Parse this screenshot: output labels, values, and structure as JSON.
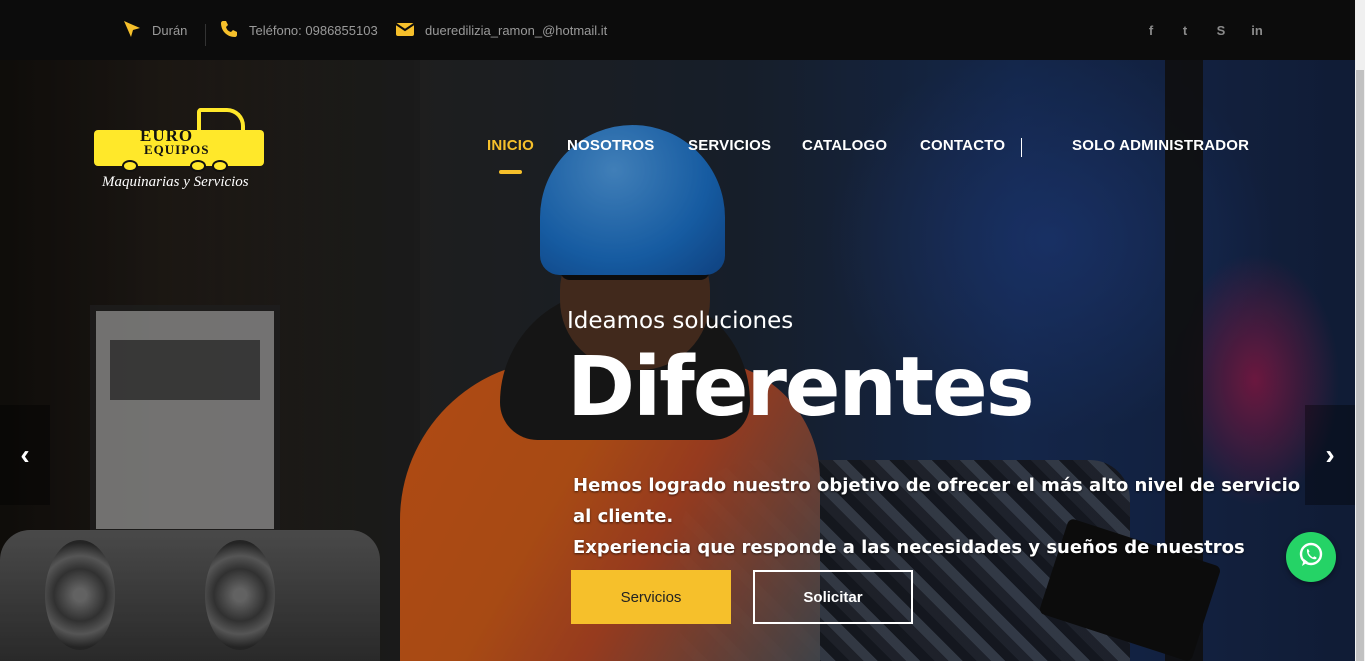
{
  "topbar": {
    "location": "Durán",
    "phone": "Teléfono: 0986855103",
    "email": "dueredilizia_ramon_@hotmail.it",
    "social": [
      {
        "icon": "facebook-icon",
        "glyph": "f"
      },
      {
        "icon": "twitter-icon",
        "glyph": "t"
      },
      {
        "icon": "skype-icon",
        "glyph": "S"
      },
      {
        "icon": "linkedin-icon",
        "glyph": "in"
      }
    ]
  },
  "logo": {
    "line1": "EURO",
    "line2": "EQUIPOS",
    "tagline": "Maquinarias y Servicios"
  },
  "nav": {
    "inicio": "INICIO",
    "nosotros": "NOSOTROS",
    "servicios": "SERVICIOS",
    "catalogo": "CATALOGO",
    "contacto": "CONTACTO",
    "admin": "SOLO ADMINISTRADOR"
  },
  "hero": {
    "subtitle": "Ideamos soluciones",
    "title": "Diferentes",
    "description_line1": "Hemos logrado nuestro objetivo de ofrecer el más alto nivel de servicio al cliente.",
    "description_line2": "Experiencia que responde a las necesidades y sueños de nuestros clientes.",
    "primary_button": "Servicios",
    "secondary_button": "Solicitar"
  },
  "slider": {
    "prev_glyph": "‹",
    "next_glyph": "›"
  },
  "colors": {
    "accent": "#f6c02b",
    "topbar_bg": "#0c0c0c",
    "whatsapp": "#25d366"
  }
}
